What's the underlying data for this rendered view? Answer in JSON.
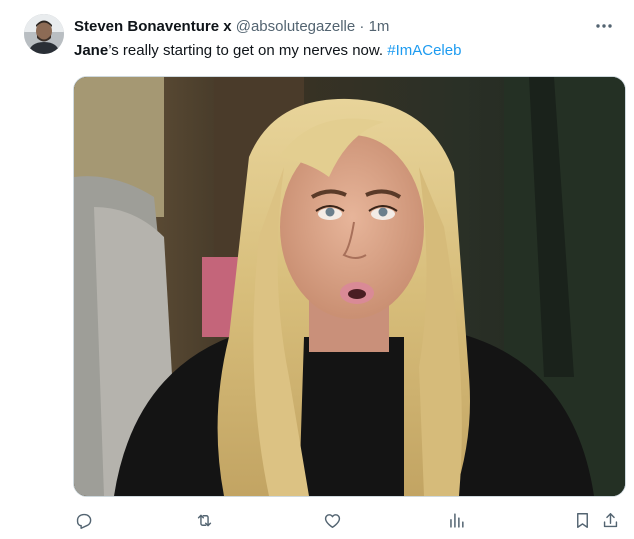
{
  "author": {
    "display_name": "Steven Bonaventure x",
    "handle": "@absolutegazelle",
    "separator": "·",
    "time": "1m",
    "avatar_icon": "user-avatar"
  },
  "tweet": {
    "mention": "Jane",
    "body": "’s really starting to get on my nerves now. ",
    "hashtag": "#ImACeleb"
  },
  "media": {
    "type": "photo"
  },
  "actions": {
    "reply_icon": "reply-icon",
    "retweet_icon": "retweet-icon",
    "like_icon": "heart-icon",
    "views_icon": "views-icon",
    "bookmark_icon": "bookmark-icon",
    "share_icon": "share-icon"
  },
  "colors": {
    "link": "#1d9bf0",
    "muted": "#536471",
    "text": "#0f1419"
  }
}
